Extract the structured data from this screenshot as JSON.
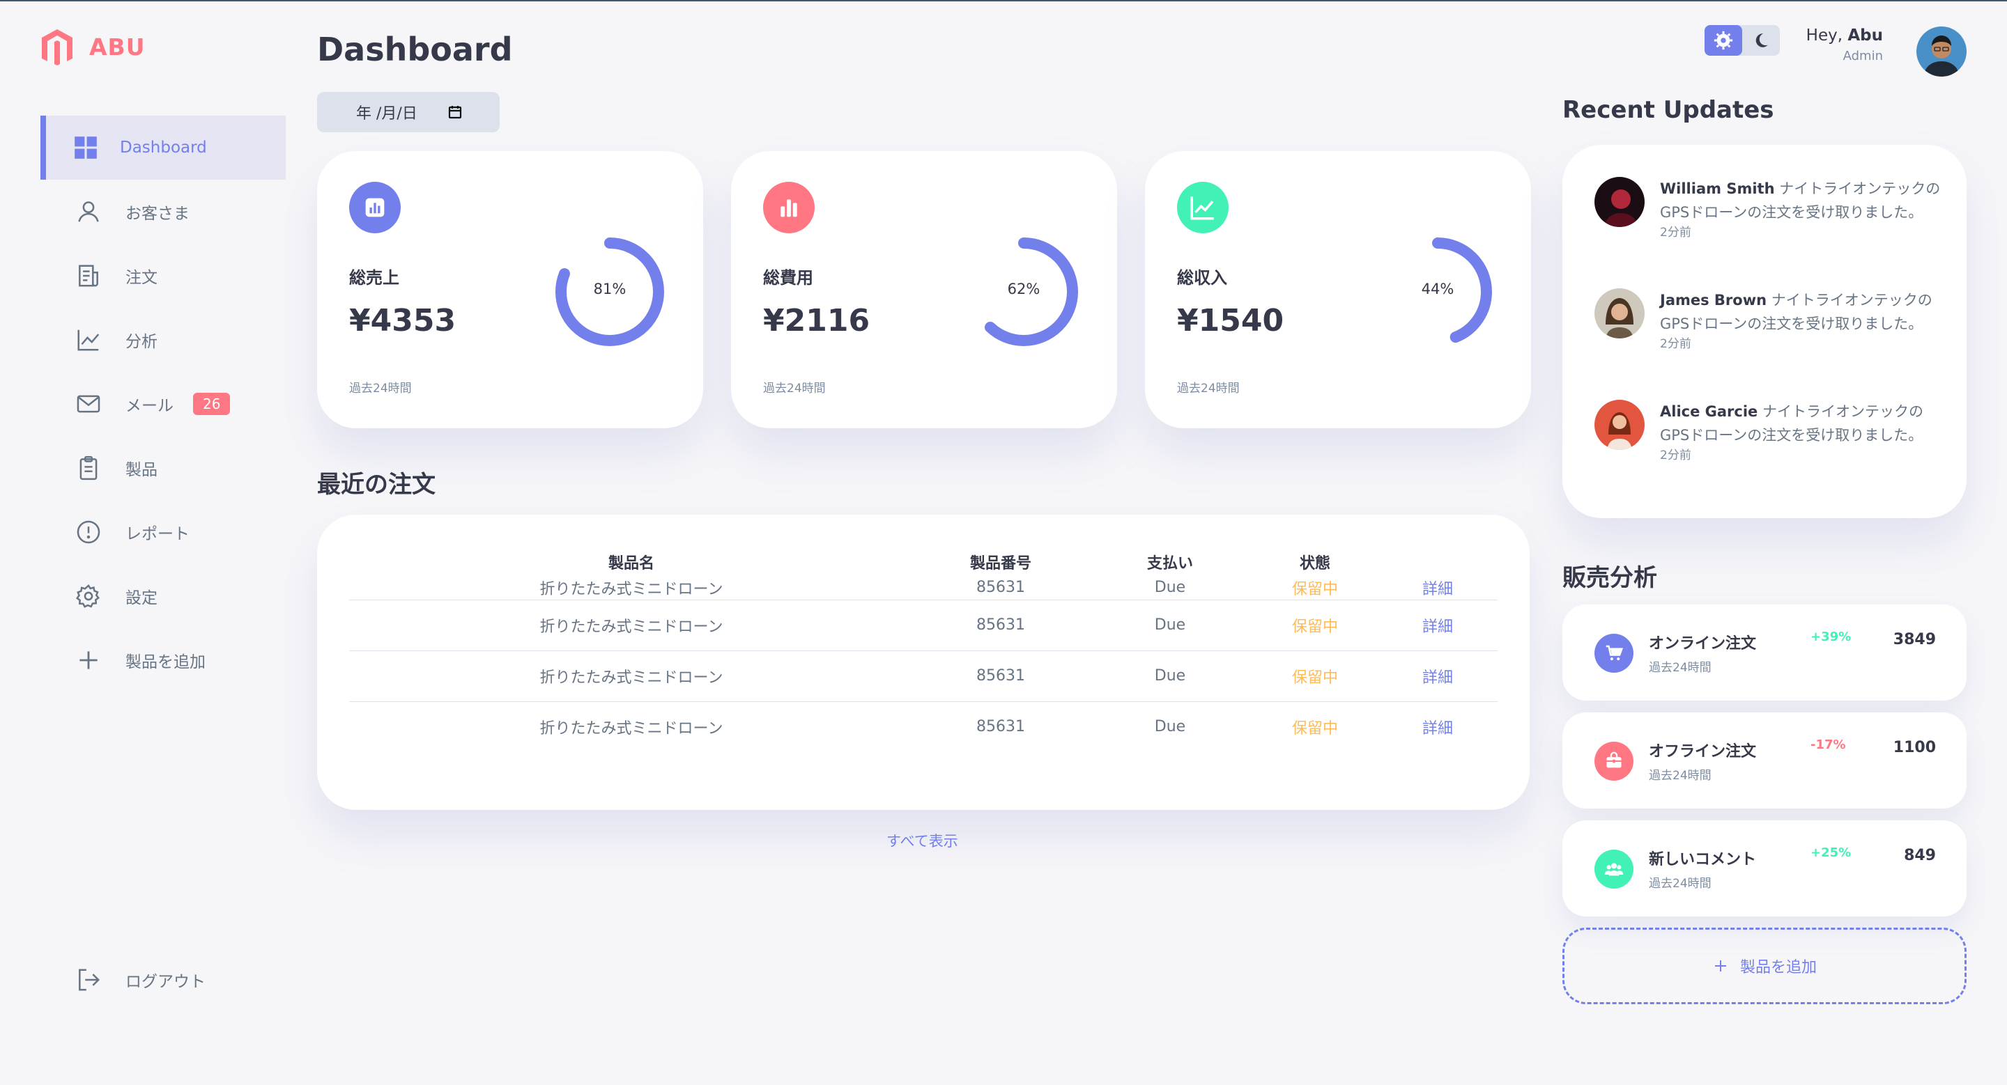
{
  "brand": {
    "name": "ABU",
    "color": "#ff7782"
  },
  "colors": {
    "primary": "#7380ec",
    "danger": "#ff7782",
    "success": "#41f1b6",
    "warning": "#ffbb55"
  },
  "sidebar": {
    "items": [
      {
        "label": "Dashboard",
        "icon": "grid-icon",
        "active": true
      },
      {
        "label": "お客さま",
        "icon": "person-icon"
      },
      {
        "label": "注文",
        "icon": "receipt-icon"
      },
      {
        "label": "分析",
        "icon": "chart-line-icon"
      },
      {
        "label": "メール",
        "icon": "mail-icon",
        "badge": "26"
      },
      {
        "label": "製品",
        "icon": "clipboard-icon"
      },
      {
        "label": "レポート",
        "icon": "alert-icon"
      },
      {
        "label": "設定",
        "icon": "gear-icon"
      },
      {
        "label": "製品を追加",
        "icon": "plus-icon"
      }
    ],
    "logout": "ログアウト"
  },
  "header": {
    "title": "Dashboard",
    "date_placeholder": "年 /月/日"
  },
  "cards": [
    {
      "label": "総売上",
      "value": "¥4353",
      "percent": 81,
      "percent_label": "81%",
      "foot": "過去24時間",
      "color": "#7380ec",
      "icon": "bar-chart-icon"
    },
    {
      "label": "総費用",
      "value": "¥2116",
      "percent": 62,
      "percent_label": "62%",
      "foot": "過去24時間",
      "color": "#ff7782",
      "icon": "bar-chart-icon"
    },
    {
      "label": "総収入",
      "value": "¥1540",
      "percent": 44,
      "percent_label": "44%",
      "foot": "過去24時間",
      "color": "#41f1b6",
      "icon": "trend-up-icon"
    }
  ],
  "orders": {
    "title": "最近の注文",
    "columns": [
      "製品名",
      "製品番号",
      "支払い",
      "状態",
      ""
    ],
    "rows": [
      {
        "name": "折りたたみ式ミニドローン",
        "number": "85631",
        "payment": "Due",
        "status": "保留中",
        "action": "詳細"
      },
      {
        "name": "折りたたみ式ミニドローン",
        "number": "85631",
        "payment": "Due",
        "status": "保留中",
        "action": "詳細"
      },
      {
        "name": "折りたたみ式ミニドローン",
        "number": "85631",
        "payment": "Due",
        "status": "保留中",
        "action": "詳細"
      },
      {
        "name": "折りたたみ式ミニドローン",
        "number": "85631",
        "payment": "Due",
        "status": "保留中",
        "action": "詳細"
      }
    ],
    "show_all": "すべて表示"
  },
  "profile": {
    "greeting": "Hey, ",
    "name": "Abu",
    "role": "Admin"
  },
  "updates": {
    "title": "Recent Updates",
    "items": [
      {
        "name": "William Smith",
        "text": " ナイトライオンテックのGPSドローンの注文を受け取りました。",
        "time": "2分前"
      },
      {
        "name": "James Brown",
        "text": " ナイトライオンテックのGPSドローンの注文を受け取りました。",
        "time": "2分前"
      },
      {
        "name": "Alice Garcie",
        "text": " ナイトライオンテックのGPSドローンの注文を受け取りました。",
        "time": "2分前"
      }
    ]
  },
  "sales": {
    "title": "販売分析",
    "items": [
      {
        "name": "オンライン注文",
        "sub": "過去24時間",
        "percent": "+39%",
        "count": "3849",
        "color": "#7380ec",
        "pct_color": "#41f1b6",
        "icon": "cart-icon"
      },
      {
        "name": "オフライン注文",
        "sub": "過去24時間",
        "percent": "-17%",
        "count": "1100",
        "color": "#ff7782",
        "pct_color": "#ff7782",
        "icon": "bag-icon"
      },
      {
        "name": "新しいコメント",
        "sub": "過去24時間",
        "percent": "+25%",
        "count": "849",
        "color": "#41f1b6",
        "pct_color": "#41f1b6",
        "icon": "people-icon"
      }
    ],
    "add_label": "製品を追加"
  }
}
